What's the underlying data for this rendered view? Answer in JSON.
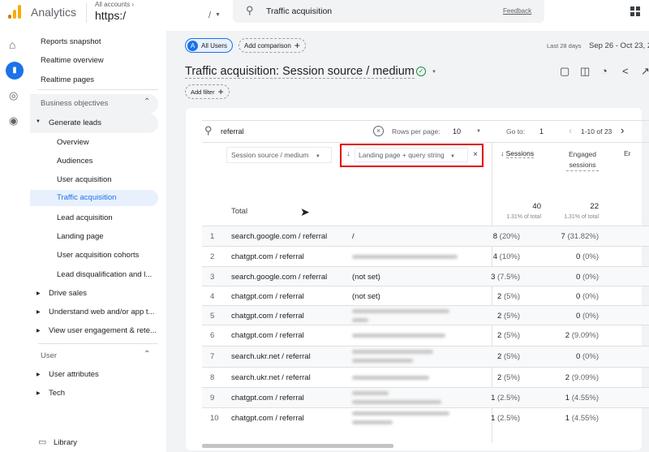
{
  "header": {
    "app_name": "Analytics",
    "account_label": "All accounts",
    "property": "https:/",
    "property_suffix": "/",
    "search_query": "Traffic acquisition",
    "feedback": "Feedback"
  },
  "sidebar": {
    "items": [
      {
        "label": "Reports snapshot"
      },
      {
        "label": "Realtime overview"
      },
      {
        "label": "Realtime pages"
      }
    ],
    "section1": "Business objectives",
    "group1": "Generate leads",
    "group1_items": [
      {
        "label": "Overview"
      },
      {
        "label": "Audiences"
      },
      {
        "label": "User acquisition"
      },
      {
        "label": "Traffic acquisition"
      },
      {
        "label": "Lead acquisition"
      },
      {
        "label": "Landing page"
      },
      {
        "label": "User acquisition cohorts"
      },
      {
        "label": "Lead disqualification and l..."
      }
    ],
    "groups": [
      {
        "label": "Drive sales"
      },
      {
        "label": "Understand web and/or app t..."
      },
      {
        "label": "View user engagement & rete..."
      }
    ],
    "section2": "User",
    "user_groups": [
      {
        "label": "User attributes"
      },
      {
        "label": "Tech"
      }
    ],
    "library": "Library"
  },
  "main": {
    "segment_chip": "All Users",
    "segment_letter": "A",
    "add_comparison": "Add comparison",
    "date_label": "Last 28 days",
    "date_range": "Sep 26 - Oct 23, 2",
    "title": "Traffic acquisition: Session source / medium",
    "add_filter": "Add filter"
  },
  "table": {
    "search_value": "referral",
    "rows_per_page_label": "Rows per page:",
    "rows_per_page": "10",
    "goto_label": "Go to:",
    "goto_value": "1",
    "pagination": "1-10 of 23",
    "dim1": "Session source / medium",
    "dim2": "Landing page + query string",
    "col_sessions": "Sessions",
    "col_engaged": "Engaged sessions",
    "col_next": "Er",
    "total_label": "Total",
    "total_sessions": "40",
    "total_sessions_pct": "1.31% of total",
    "total_engaged": "22",
    "total_engaged_pct": "1.31% of total",
    "rows": [
      {
        "n": "1",
        "source": "search.google.com / referral",
        "landing": "/",
        "s": "8",
        "sp": "(20%)",
        "e": "7",
        "ep": "(31.82%)"
      },
      {
        "n": "2",
        "source": "chatgpt.com / referral",
        "landing": "",
        "s": "4",
        "sp": "(10%)",
        "e": "0",
        "ep": "(0%)"
      },
      {
        "n": "3",
        "source": "search.google.com / referral",
        "landing": "(not set)",
        "s": "3",
        "sp": "(7.5%)",
        "e": "0",
        "ep": "(0%)"
      },
      {
        "n": "4",
        "source": "chatgpt.com / referral",
        "landing": "(not set)",
        "s": "2",
        "sp": "(5%)",
        "e": "0",
        "ep": "(0%)"
      },
      {
        "n": "5",
        "source": "chatgpt.com / referral",
        "landing": "",
        "s": "2",
        "sp": "(5%)",
        "e": "0",
        "ep": "(0%)"
      },
      {
        "n": "6",
        "source": "chatgpt.com / referral",
        "landing": "",
        "s": "2",
        "sp": "(5%)",
        "e": "2",
        "ep": "(9.09%)"
      },
      {
        "n": "7",
        "source": "search.ukr.net / referral",
        "landing": "",
        "s": "2",
        "sp": "(5%)",
        "e": "0",
        "ep": "(0%)"
      },
      {
        "n": "8",
        "source": "search.ukr.net / referral",
        "landing": "",
        "s": "2",
        "sp": "(5%)",
        "e": "2",
        "ep": "(9.09%)"
      },
      {
        "n": "9",
        "source": "chatgpt.com / referral",
        "landing": "",
        "s": "1",
        "sp": "(2.5%)",
        "e": "1",
        "ep": "(4.55%)"
      },
      {
        "n": "10",
        "source": "chatgpt.com / referral",
        "landing": "",
        "s": "1",
        "sp": "(2.5%)",
        "e": "1",
        "ep": "(4.55%)"
      }
    ]
  },
  "colors": {
    "accent": "#1a73e8",
    "highlight_box": "#e00000",
    "logo_orange": "#f9ab00",
    "logo_dark": "#e37400"
  }
}
